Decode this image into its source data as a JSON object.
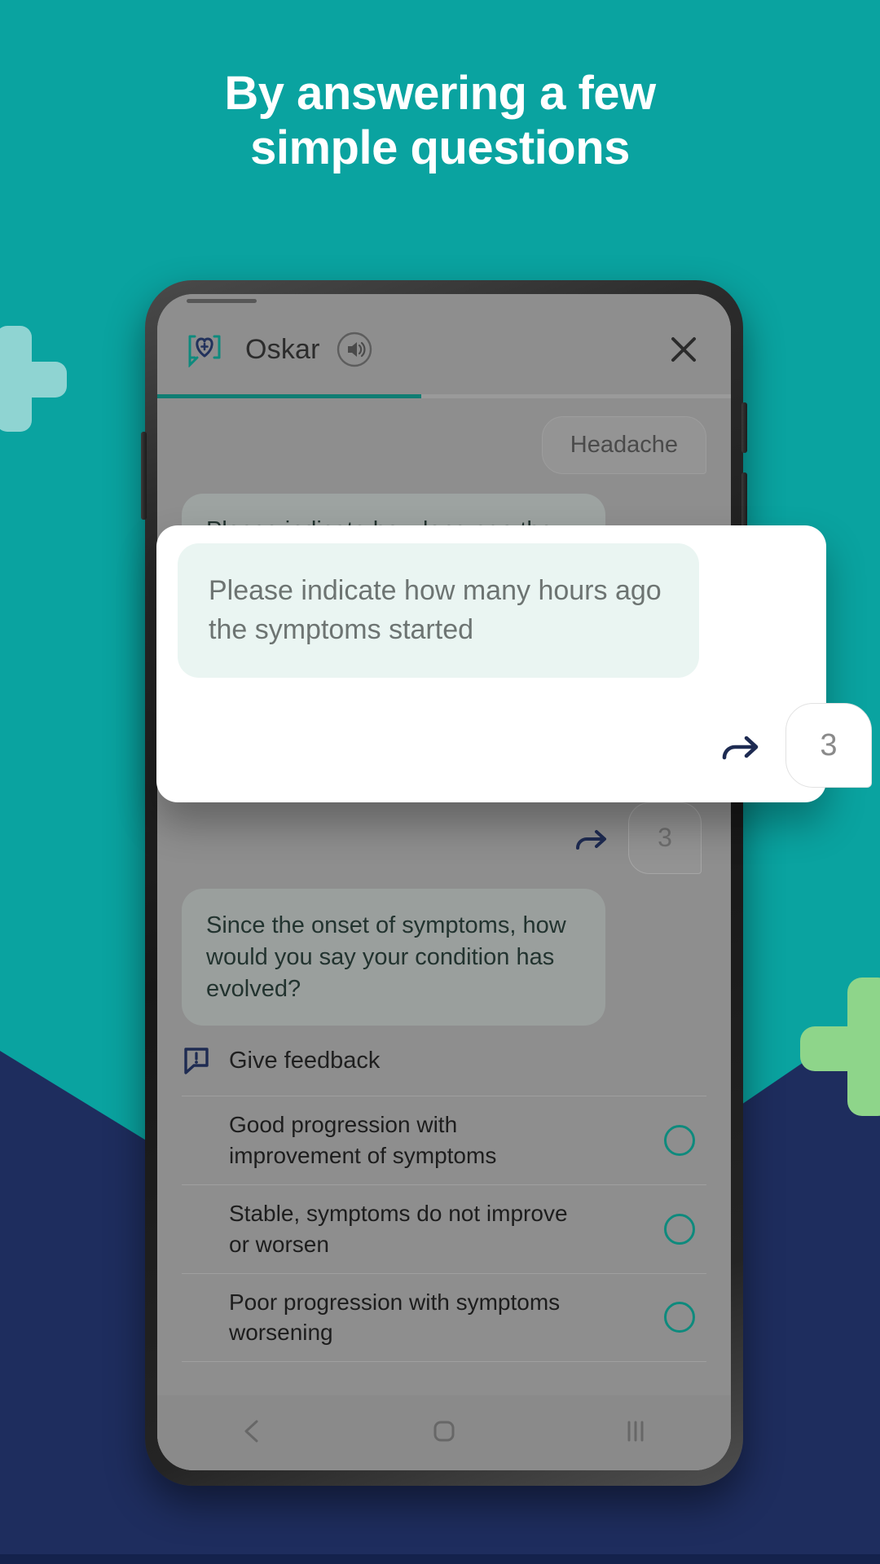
{
  "headline": {
    "line1": "By answering a few",
    "line2": "simple questions"
  },
  "colors": {
    "teal": "#0aa3a0",
    "navy": "#1e2d5e",
    "accent_green": "#8ed58a",
    "accent_light_teal": "#8fd4d2",
    "brand_dark": "#1e2b52",
    "radio_outline": "#0e8a7d"
  },
  "phone": {
    "app": {
      "header": {
        "brand_icon": "chat-heart-plus-icon",
        "title": "Oskar",
        "sound_icon": "speaker-icon",
        "close_icon": "close-icon"
      },
      "progress_percent": 46,
      "chip": "Headache",
      "background_question": "Please indicate how long ago the",
      "enter_icon": "enter-arrow-icon",
      "answer_value": "3",
      "question": "Since the onset of symptoms, how would you say your condition has evolved?",
      "feedback": {
        "icon": "feedback-alert-icon",
        "label": "Give feedback"
      },
      "options": [
        {
          "label": "Good progression with improvement of symptoms",
          "selected": false
        },
        {
          "label": "Stable, symptoms do not improve or worsen",
          "selected": false
        },
        {
          "label": "Poor progression with symptoms worsening",
          "selected": false
        }
      ]
    },
    "navbar": {
      "back_icon": "back-chevron-icon",
      "home_icon": "home-square-icon",
      "recents_icon": "recents-icon"
    }
  },
  "modal": {
    "question": "Please indicate how many hours ago the symptoms started",
    "enter_icon": "enter-arrow-icon",
    "answer_value": "3"
  }
}
